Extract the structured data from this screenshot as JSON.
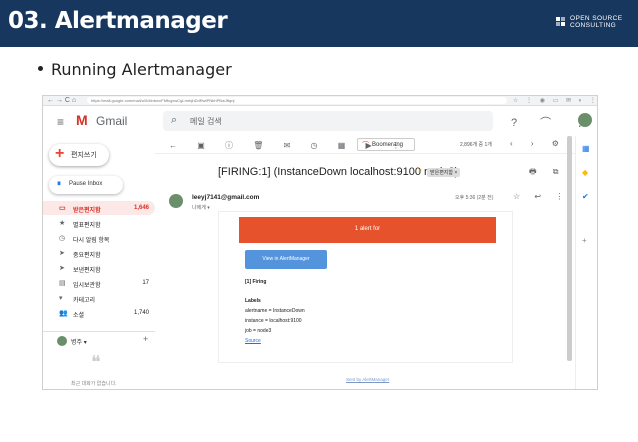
{
  "slide": {
    "title": "03. Alertmanager",
    "bullet": "Running Alertmanager",
    "logo_line1": "OPEN SOURCE",
    "logo_line2": "CONSULTING"
  },
  "browser": {
    "url": "https://mail.google.com/mail/u/0/#inbox/FMfcgxwCgLmrbjhDdRwtPNbhPBwJftqnj",
    "nav_icons": "← → C ⌂",
    "chrome_icons": "☆ ⋮ ◉ ▭ ✉ ◐ ⋮"
  },
  "gmail": {
    "app_name": "Gmail",
    "logo_glyph": "M",
    "hamburger_glyph": "≡",
    "search_placeholder": "메일 검색",
    "search_glyph": "⌕",
    "top_right_glyphs": "? ⌒ ⋮⋮⋮",
    "compose_label": "편지쓰기",
    "compose_glyph": "+",
    "pause_label": "Pause Inbox",
    "pause_glyph": "⏸",
    "sidebar": [
      {
        "icon": "▭",
        "label": "받은편지함",
        "count": "1,646",
        "active": true
      },
      {
        "icon": "★",
        "label": "별표편지함",
        "count": ""
      },
      {
        "icon": "◷",
        "label": "다시 알림 항목",
        "count": ""
      },
      {
        "icon": "➤",
        "label": "중요편지함",
        "count": ""
      },
      {
        "icon": "➤",
        "label": "보낸편지함",
        "count": ""
      },
      {
        "icon": "▤",
        "label": "임시보관함",
        "count": "17"
      },
      {
        "icon": "▾",
        "label": "카테고리",
        "count": ""
      },
      {
        "icon": "👥",
        "label": "소셜",
        "count": "1,740"
      }
    ],
    "hangouts_name": "병주 ▾",
    "hangouts_plus": "+",
    "hangouts_bubble": "❝",
    "hangouts_empty": "최근 대화가 없습니다.",
    "toolbar_glyphs": "← ▣ ⓘ 🗑 ✉ ◷ ▦ ▶ ⋮",
    "boomerang_label": "Boomerang",
    "boomerang_glyph": "⌒",
    "page_info": "2,896개 중 1개",
    "toolbar_right_glyphs": "‹ › ⚙",
    "subject": "[FIRING:1] (InstanceDown localhost:9100 node3)",
    "important_glyph": "»",
    "label_chip": "받은편지함 ×",
    "subject_right_glyphs": "🖶 ⧉",
    "sender": "leeyj7141@gmail.com",
    "to_me": "나에게 ▾",
    "mail_time": "오후 5:36 (2분 전)",
    "mail_action_glyphs": "☆ ↩ ⋮",
    "alert_banner": "1 alert for",
    "view_button": "View in AlertManager",
    "firing_heading": "[1] Firing",
    "labels_heading": "Labels",
    "label_lines": [
      "alertname = InstanceDown",
      "instance = localhost:9100",
      "job = node3"
    ],
    "source_link": "Source",
    "sent_by": "Sent by AlertManager",
    "rail_icons": [
      "▦",
      "◆",
      "✔",
      "+"
    ]
  },
  "colors": {
    "header_bg": "#17375e",
    "alert_banner": "#e6522c",
    "view_button": "#5494dc",
    "gmail_red": "#d93025"
  }
}
